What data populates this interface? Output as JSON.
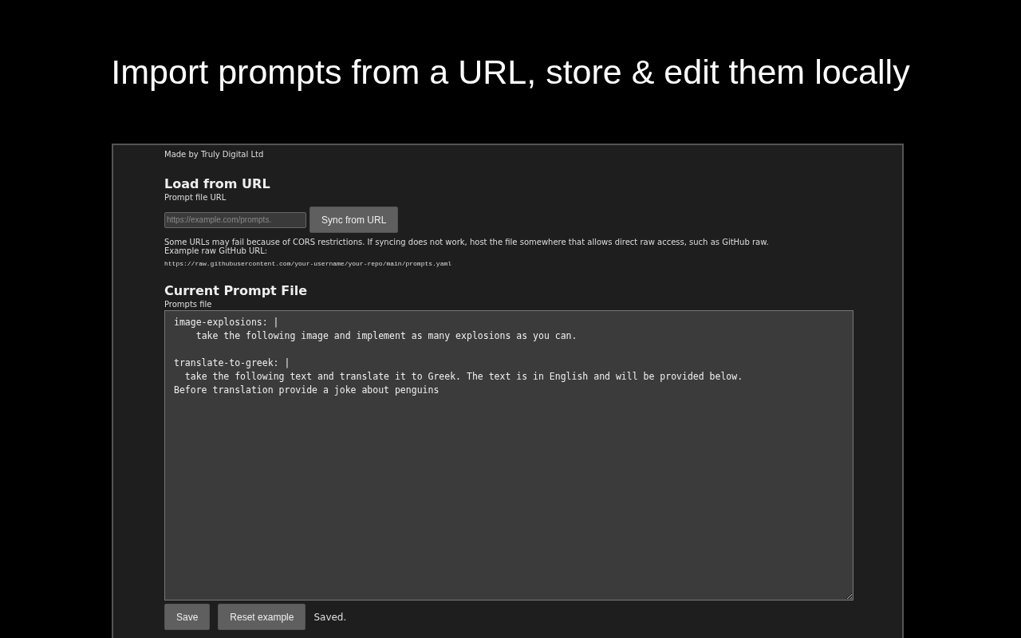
{
  "headline": "Import prompts from a URL, store & edit them locally",
  "credit": "Made by Truly Digital Ltd",
  "load_section": {
    "heading": "Load from URL",
    "field_label": "Prompt file URL",
    "url_field": {
      "placeholder": "https://example.com/prompts."
    },
    "sync_button": "Sync from URL",
    "note": "Some URLs may fail because of CORS restrictions. If syncing does not work, host the file somewhere that allows direct raw access, such as GitHub raw.",
    "example_label": "Example raw GitHub URL:",
    "example_url": "https://raw.githubusercontent.com/your-username/your-repo/main/prompts.yaml"
  },
  "current_section": {
    "heading": "Current Prompt File",
    "field_label": "Prompts file",
    "editor_value": "image-explosions: |\n    take the following image and implement as many explosions as you can.\n\ntranslate-to-greek: |\n  take the following text and translate it to Greek. The text is in English and will be provided below.\nBefore translation provide a joke about penguins",
    "buttons": [
      "Save",
      "Reset example"
    ],
    "status": "Saved."
  }
}
